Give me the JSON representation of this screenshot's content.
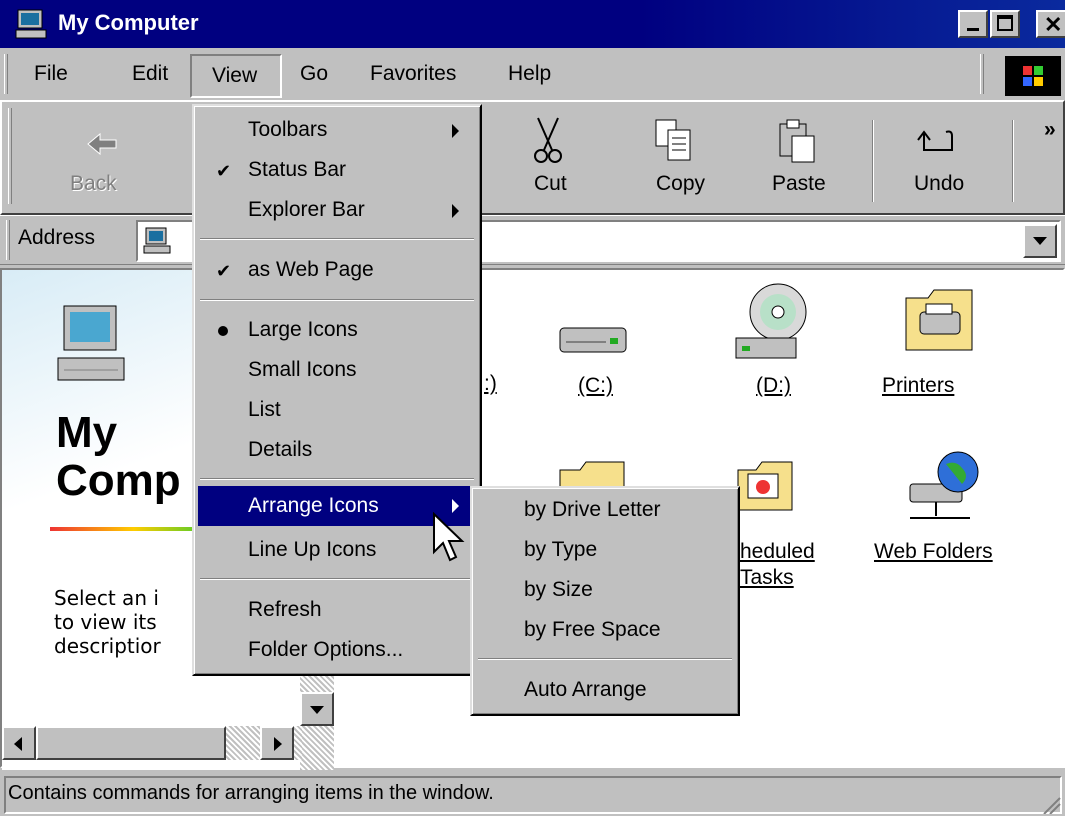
{
  "window": {
    "title": "My Computer"
  },
  "menubar": {
    "file": "File",
    "edit": "Edit",
    "view": "View",
    "go": "Go",
    "favorites": "Favorites",
    "help": "Help"
  },
  "toolbar": {
    "back": "Back",
    "cut": "Cut",
    "copy": "Copy",
    "paste": "Paste",
    "undo": "Undo",
    "more": "»"
  },
  "address": {
    "label": "Address"
  },
  "left_panel": {
    "title_line1": "My",
    "title_line2": "Comp",
    "desc_line1": "Select an i",
    "desc_line2": "to view its",
    "desc_line3": "descriptior"
  },
  "icons": {
    "a_drive": ":)",
    "c_drive": "(C:)",
    "d_drive": "(D:)",
    "printers": "Printers",
    "scheduled_line1": "heduled",
    "scheduled_line2": "Tasks",
    "web_folders": "Web Folders"
  },
  "view_menu": {
    "toolbars": "Toolbars",
    "status_bar": "Status Bar",
    "explorer_bar": "Explorer Bar",
    "as_web_page": "as Web Page",
    "large_icons": "Large Icons",
    "small_icons": "Small Icons",
    "list": "List",
    "details": "Details",
    "arrange_icons": "Arrange Icons",
    "line_up_icons": "Line Up Icons",
    "refresh": "Refresh",
    "folder_options": "Folder Options..."
  },
  "arrange_menu": {
    "by_drive_letter": "by Drive Letter",
    "by_type": "by Type",
    "by_size": "by Size",
    "by_free_space": "by Free Space",
    "auto_arrange": "Auto Arrange"
  },
  "status": {
    "text": "Contains commands for arranging items in the window."
  },
  "colors": {
    "titlebar": "#000080",
    "face": "#c0c0c0",
    "highlight": "#000080"
  }
}
